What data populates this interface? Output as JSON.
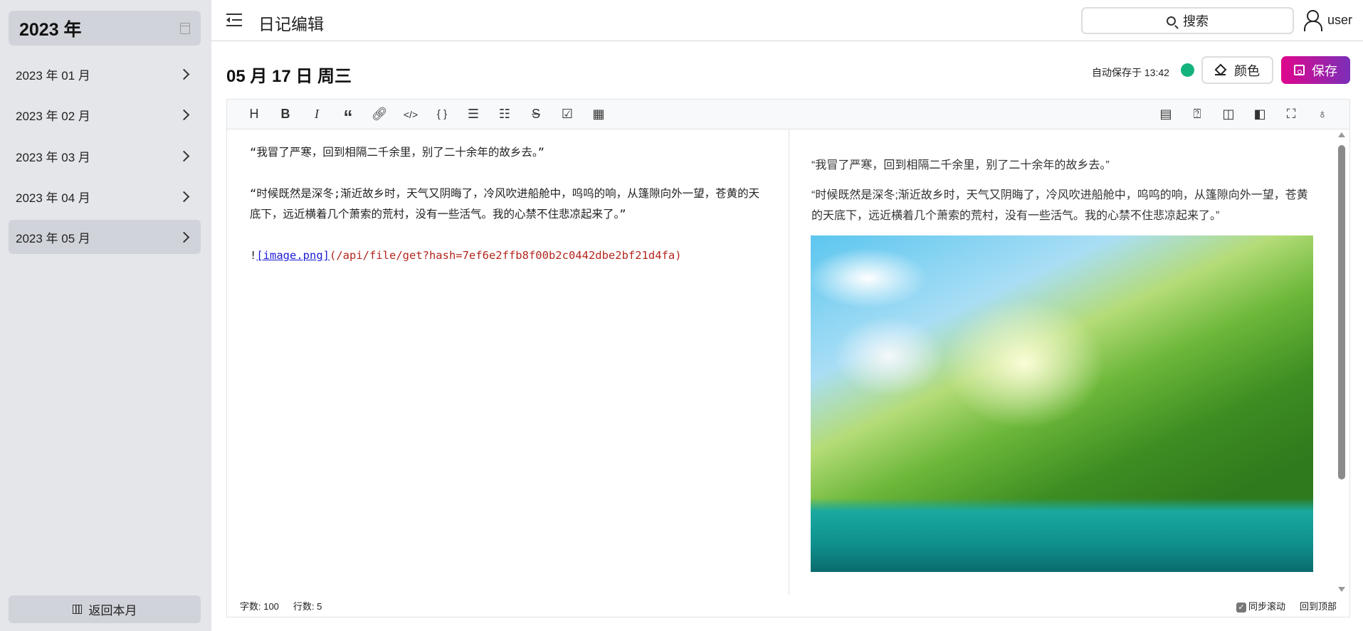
{
  "sidebar": {
    "year": "2023 年",
    "months": [
      "2023 年 01 月",
      "2023 年 02 月",
      "2023 年 03 月",
      "2023 年 04 月",
      "2023 年 05 月"
    ],
    "active_month": 4,
    "back_label": "返回本月"
  },
  "header": {
    "title": "日记编辑",
    "search_label": "搜索",
    "user": "user"
  },
  "page": {
    "date": "05 月 17 日 周三",
    "autosave": "自动保存于 13:42",
    "status_color": "#14b37d",
    "color_label": "颜色",
    "save_label": "保存"
  },
  "toolbar": {
    "left": [
      "H",
      "B",
      "I",
      "“",
      "link",
      "</>",
      "{ }",
      "ul",
      "ol",
      "S",
      "task",
      "table"
    ],
    "right": [
      "contents",
      "help",
      "preview-only",
      "editor-only",
      "fullscreen",
      "github"
    ]
  },
  "editor": {
    "lines": [
      "“我冒了严寒，回到相隔二千余里，别了二十余年的故乡去。”",
      "“时候既然是深冬;渐近故乡时，天气又阴晦了，冷风吹进船舱中，呜呜的响，从篷隙向外一望，苍黄的天底下，远近横着几个萧索的荒村，没有一些活气。我的心禁不住悲凉起来了。”"
    ],
    "image_md_prefix": "!",
    "image_md_text": "[image.png]",
    "image_md_url": "(/api/file/get?hash=7ef6e2ffb8f00b2c0442dbe2bf21d4fa)"
  },
  "preview": {
    "lines": [
      "“我冒了严寒，回到相隔二千余里，别了二十余年的故乡去。”",
      "“时候既然是深冬;渐近故乡时，天气又阴晦了，冷风吹进船舱中，呜呜的响，从篷隙向外一望，苍黄的天底下，远近横着几个萧索的荒村，没有一些活气。我的心禁不住悲凉起来了。”"
    ]
  },
  "footer": {
    "word_count": "字数: 100",
    "line_count": "行数: 5",
    "sync_scroll": "同步滚动",
    "back_to_top": "回到顶部"
  }
}
